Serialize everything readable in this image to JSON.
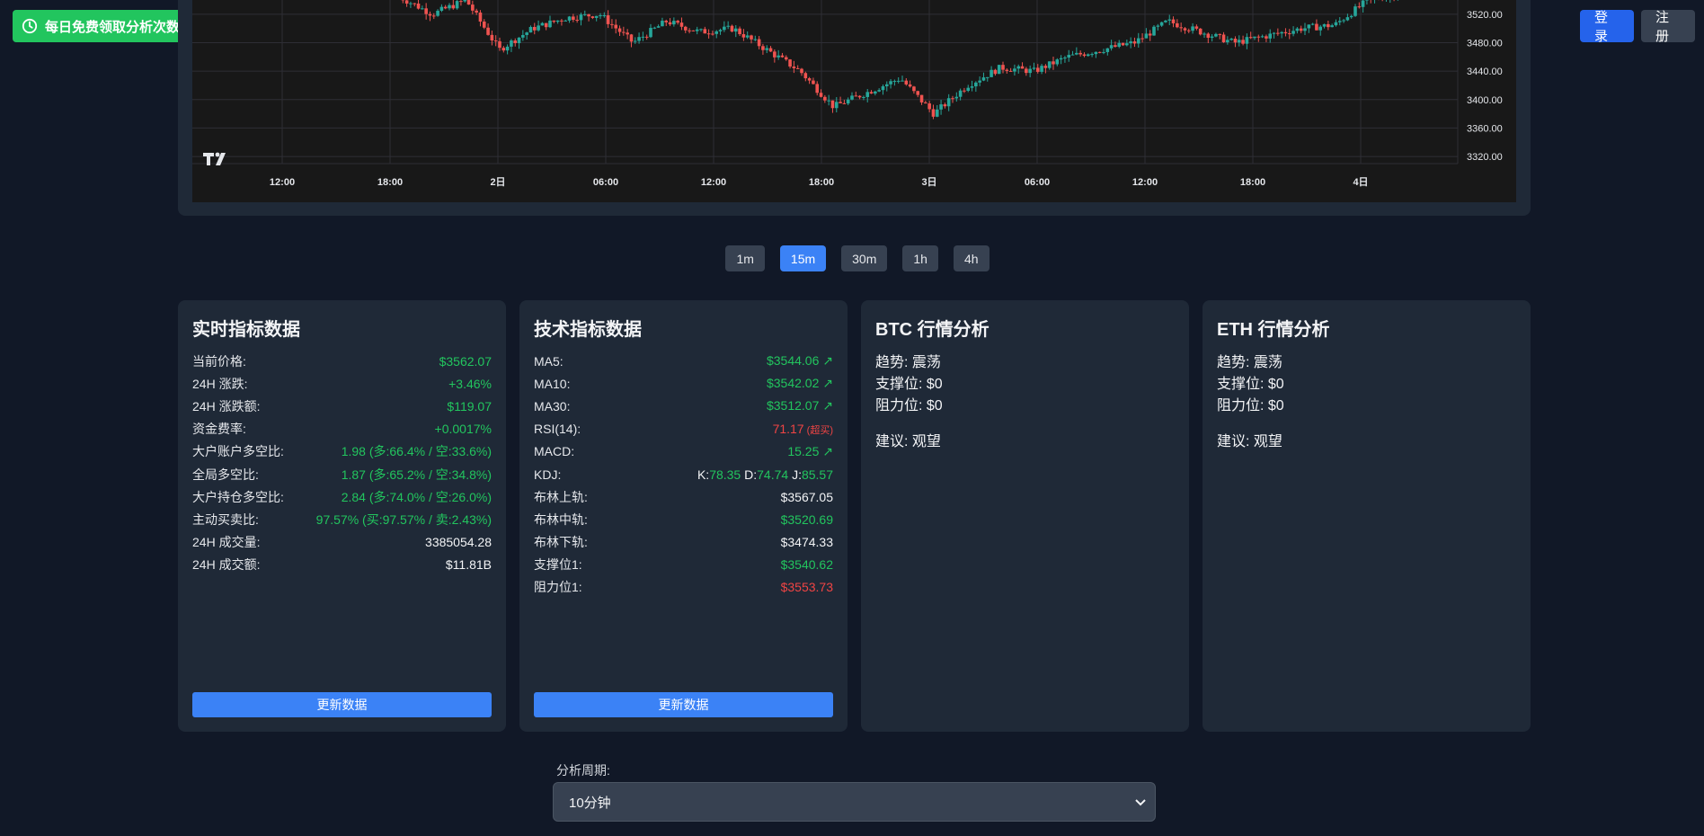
{
  "promo": {
    "label": "每日免费领取分析次数",
    "color": "#22c55e"
  },
  "auth": {
    "login": "登录",
    "register": "注册"
  },
  "chart": {
    "y_ticks": [
      "3520.00",
      "3480.00",
      "3440.00",
      "3400.00",
      "3360.00",
      "3320.00"
    ],
    "x_ticks": [
      "12:00",
      "18:00",
      "2日",
      "06:00",
      "12:00",
      "18:00",
      "3日",
      "06:00",
      "12:00",
      "18:00",
      "4日"
    ],
    "up_color": "#26a69a",
    "down_color": "#ef5350"
  },
  "chart_data": {
    "type": "candlestick",
    "x": [
      "12:00",
      "18:00",
      "2日",
      "06:00",
      "12:00",
      "18:00",
      "3日",
      "06:00",
      "12:00",
      "18:00",
      "4日"
    ],
    "ylim": [
      3310,
      3540
    ],
    "close_trace": [
      3545,
      3520,
      3540,
      3470,
      3500,
      3515,
      3520,
      3480,
      3510,
      3495,
      3500,
      3470,
      3440,
      3390,
      3410,
      3430,
      3380,
      3420,
      3445,
      3440,
      3460,
      3470,
      3480,
      3510,
      3495,
      3480,
      3490,
      3500,
      3505,
      3540,
      3550
    ]
  },
  "timeframes": {
    "items": [
      "1m",
      "15m",
      "30m",
      "1h",
      "4h"
    ],
    "active": "15m"
  },
  "realtime": {
    "title": "实时指标数据",
    "rows": [
      {
        "k": "当前价格:",
        "v": "$3562.07"
      },
      {
        "k": "24H 涨跌:",
        "v": "+3.46%"
      },
      {
        "k": "24H 涨跌额:",
        "v": "$119.07"
      },
      {
        "k": "资金费率:",
        "v": "+0.0017%"
      },
      {
        "k": "大户账户多空比:",
        "v": "1.98 (多:66.4% / 空:33.6%)"
      },
      {
        "k": "全局多空比:",
        "v": "1.87 (多:65.2% / 空:34.8%)"
      },
      {
        "k": "大户持仓多空比:",
        "v": "2.84 (多:74.0% / 空:26.0%)"
      },
      {
        "k": "主动买卖比:",
        "v": "97.57% (买:97.57% / 卖:2.43%)"
      },
      {
        "k": "24H 成交量:",
        "v": "3385054.28"
      },
      {
        "k": "24H 成交额:",
        "v": "$11.81B"
      }
    ],
    "button": "更新数据"
  },
  "technical": {
    "title": "技术指标数据",
    "rows": [
      {
        "k": "MA5:",
        "v": "$3544.06 ↗"
      },
      {
        "k": "MA10:",
        "v": "$3542.02 ↗"
      },
      {
        "k": "MA30:",
        "v": "$3512.07 ↗"
      },
      {
        "k": "RSI(14):",
        "v": "71.17",
        "note": "(超买)"
      },
      {
        "k": "MACD:",
        "v": "15.25 ↗"
      },
      {
        "k": "KDJ:",
        "kdj": {
          "k_label": "K:",
          "k": "78.35",
          "d_label": "D:",
          "d": "74.74",
          "j_label": "J:",
          "j": "85.57"
        }
      },
      {
        "k": "布林上轨:",
        "v": "$3567.05"
      },
      {
        "k": "布林中轨:",
        "v": "$3520.69"
      },
      {
        "k": "布林下轨:",
        "v": "$3474.33"
      },
      {
        "k": "支撑位1:",
        "v": "$3540.62"
      },
      {
        "k": "阻力位1:",
        "v": "$3553.73"
      }
    ],
    "button": "更新数据"
  },
  "btc": {
    "title": "BTC 行情分析",
    "trend": "趋势: 震荡",
    "support": "支撑位: $0",
    "resistance": "阻力位: $0",
    "advice": "建议: 观望"
  },
  "eth": {
    "title": "ETH 行情分析",
    "trend": "趋势: 震荡",
    "support": "支撑位: $0",
    "resistance": "阻力位: $0",
    "advice": "建议: 观望"
  },
  "period": {
    "label": "分析周期:",
    "value": "10分钟"
  }
}
